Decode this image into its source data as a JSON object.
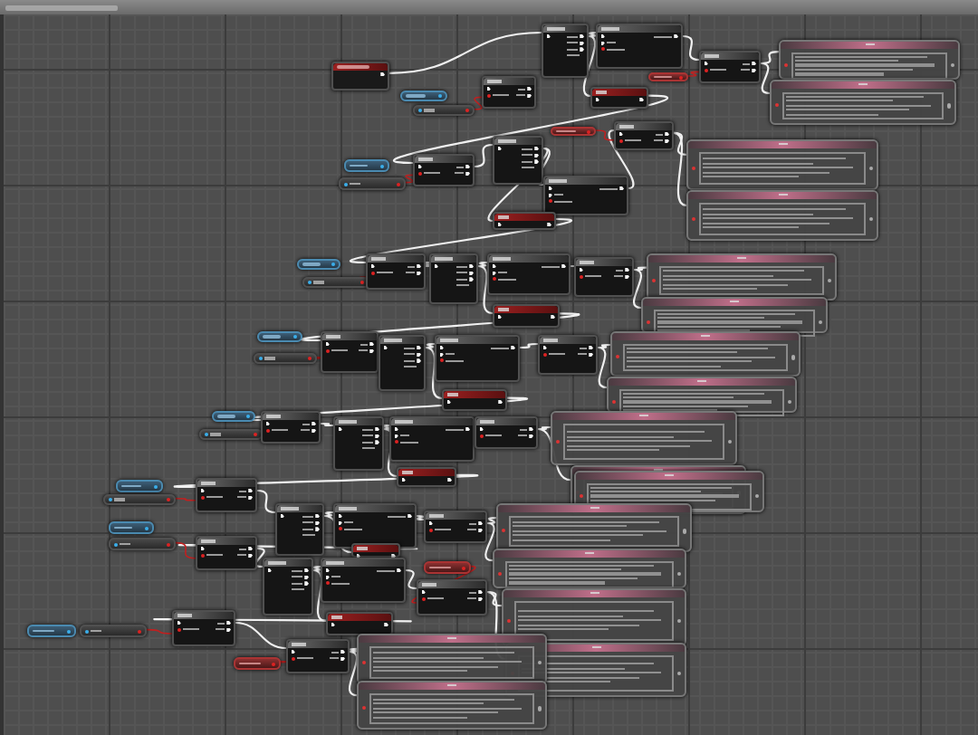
{
  "graph": {
    "nodes": [
      {
        "kind": "event"
      },
      {
        "kind": "getter"
      },
      {
        "kind": "target"
      },
      {
        "kind": "branch"
      },
      {
        "kind": "sequence"
      },
      {
        "kind": "doonce"
      },
      {
        "kind": "set"
      },
      {
        "kind": "pill"
      },
      {
        "kind": "branch"
      },
      {
        "kind": "dialogue"
      },
      {
        "kind": "dialogue"
      },
      {
        "kind": "getter"
      },
      {
        "kind": "target"
      },
      {
        "kind": "branch"
      },
      {
        "kind": "sequence"
      },
      {
        "kind": "doonce"
      },
      {
        "kind": "set"
      },
      {
        "kind": "pill"
      },
      {
        "kind": "branch"
      },
      {
        "kind": "dialogue"
      },
      {
        "kind": "dialogue"
      },
      {
        "kind": "getter"
      },
      {
        "kind": "target"
      },
      {
        "kind": "branch"
      },
      {
        "kind": "sequence"
      },
      {
        "kind": "doonce"
      },
      {
        "kind": "set"
      },
      {
        "kind": "branch"
      },
      {
        "kind": "dialogue"
      },
      {
        "kind": "dialogue"
      },
      {
        "kind": "getter"
      },
      {
        "kind": "target"
      },
      {
        "kind": "branch"
      },
      {
        "kind": "sequence"
      },
      {
        "kind": "doonce"
      },
      {
        "kind": "branch"
      },
      {
        "kind": "set"
      },
      {
        "kind": "dialogue"
      },
      {
        "kind": "dialogue"
      },
      {
        "kind": "getter"
      },
      {
        "kind": "target"
      },
      {
        "kind": "branch"
      },
      {
        "kind": "sequence"
      },
      {
        "kind": "doonce"
      },
      {
        "kind": "branch"
      },
      {
        "kind": "set"
      },
      {
        "kind": "dialogue"
      },
      {
        "kind": "dialogue"
      },
      {
        "kind": "getter"
      },
      {
        "kind": "target"
      },
      {
        "kind": "branch"
      },
      {
        "kind": "sequence"
      },
      {
        "kind": "doonce"
      },
      {
        "kind": "branch"
      },
      {
        "kind": "set"
      },
      {
        "kind": "getter"
      },
      {
        "kind": "target"
      },
      {
        "kind": "branch"
      },
      {
        "kind": "sequence"
      },
      {
        "kind": "doonce"
      },
      {
        "kind": "set"
      },
      {
        "kind": "pill"
      },
      {
        "kind": "branch"
      },
      {
        "kind": "getter"
      },
      {
        "kind": "target"
      },
      {
        "kind": "branch"
      },
      {
        "kind": "pill"
      },
      {
        "kind": "branch"
      },
      {
        "kind": "dialogue"
      },
      {
        "kind": "dialogue"
      },
      {
        "kind": "dialogue"
      },
      {
        "kind": "dialogue"
      },
      {
        "kind": "dialogue"
      },
      {
        "kind": "dialogue"
      },
      {
        "kind": "dialogue"
      }
    ]
  }
}
